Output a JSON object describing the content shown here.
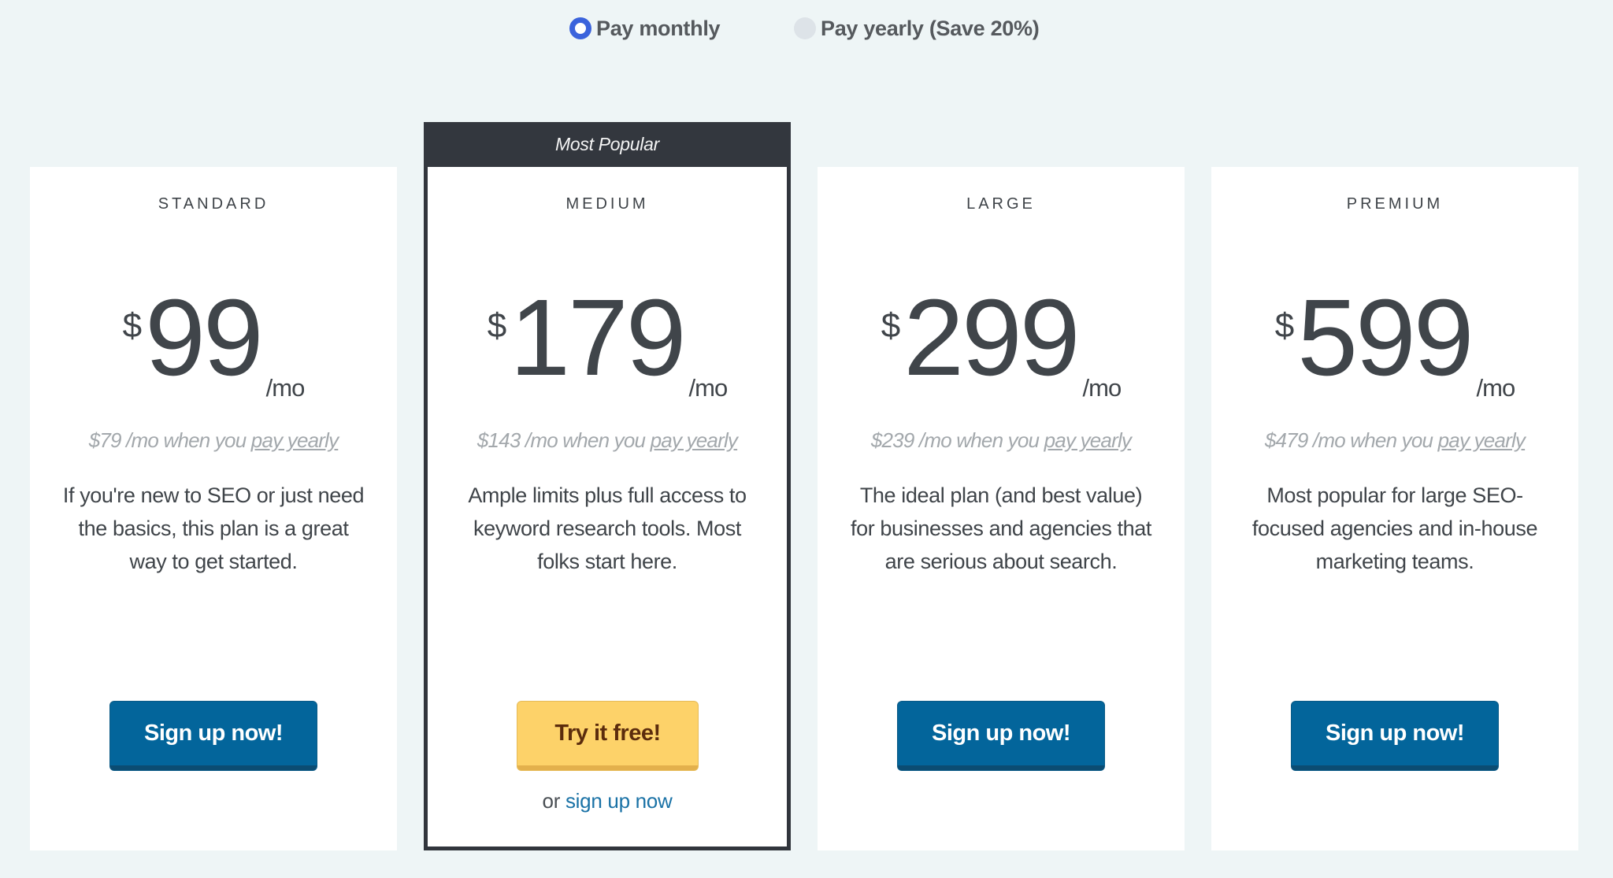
{
  "billing": {
    "options": [
      {
        "label": "Pay monthly",
        "selected": true
      },
      {
        "label": "Pay yearly (Save 20%)",
        "selected": false
      }
    ]
  },
  "colors": {
    "accent_radio": "#3b63dc",
    "primary_button": "#03659b",
    "trial_button": "#fdd269",
    "popular_banner": "#33373e",
    "link": "#1a72a6"
  },
  "plans": [
    {
      "name": "STANDARD",
      "currency": "$",
      "price": "99",
      "period": "/mo",
      "yearly_prefix": "$79 /mo when you ",
      "yearly_link": "pay yearly",
      "description": "If you're new to SEO or just need the basics, this plan is a great way to get started.",
      "cta": "Sign up now!"
    },
    {
      "name": "MEDIUM",
      "badge": "Most Popular",
      "currency": "$",
      "price": "179",
      "period": "/mo",
      "yearly_prefix": "$143 /mo when you ",
      "yearly_link": "pay yearly",
      "description": "Ample limits plus full access to keyword research tools. Most folks start here.",
      "cta": "Try it free!",
      "alt_prefix": "or ",
      "alt_link": "sign up now"
    },
    {
      "name": "LARGE",
      "currency": "$",
      "price": "299",
      "period": "/mo",
      "yearly_prefix": "$239 /mo when you ",
      "yearly_link": "pay yearly",
      "description": "The ideal plan (and best value) for businesses and agencies that are serious about search.",
      "cta": "Sign up now!"
    },
    {
      "name": "PREMIUM",
      "currency": "$",
      "price": "599",
      "period": "/mo",
      "yearly_prefix": "$479 /mo when you ",
      "yearly_link": "pay yearly",
      "description": "Most popular for large SEO-focused agencies and in-house marketing teams.",
      "cta": "Sign up now!"
    }
  ]
}
